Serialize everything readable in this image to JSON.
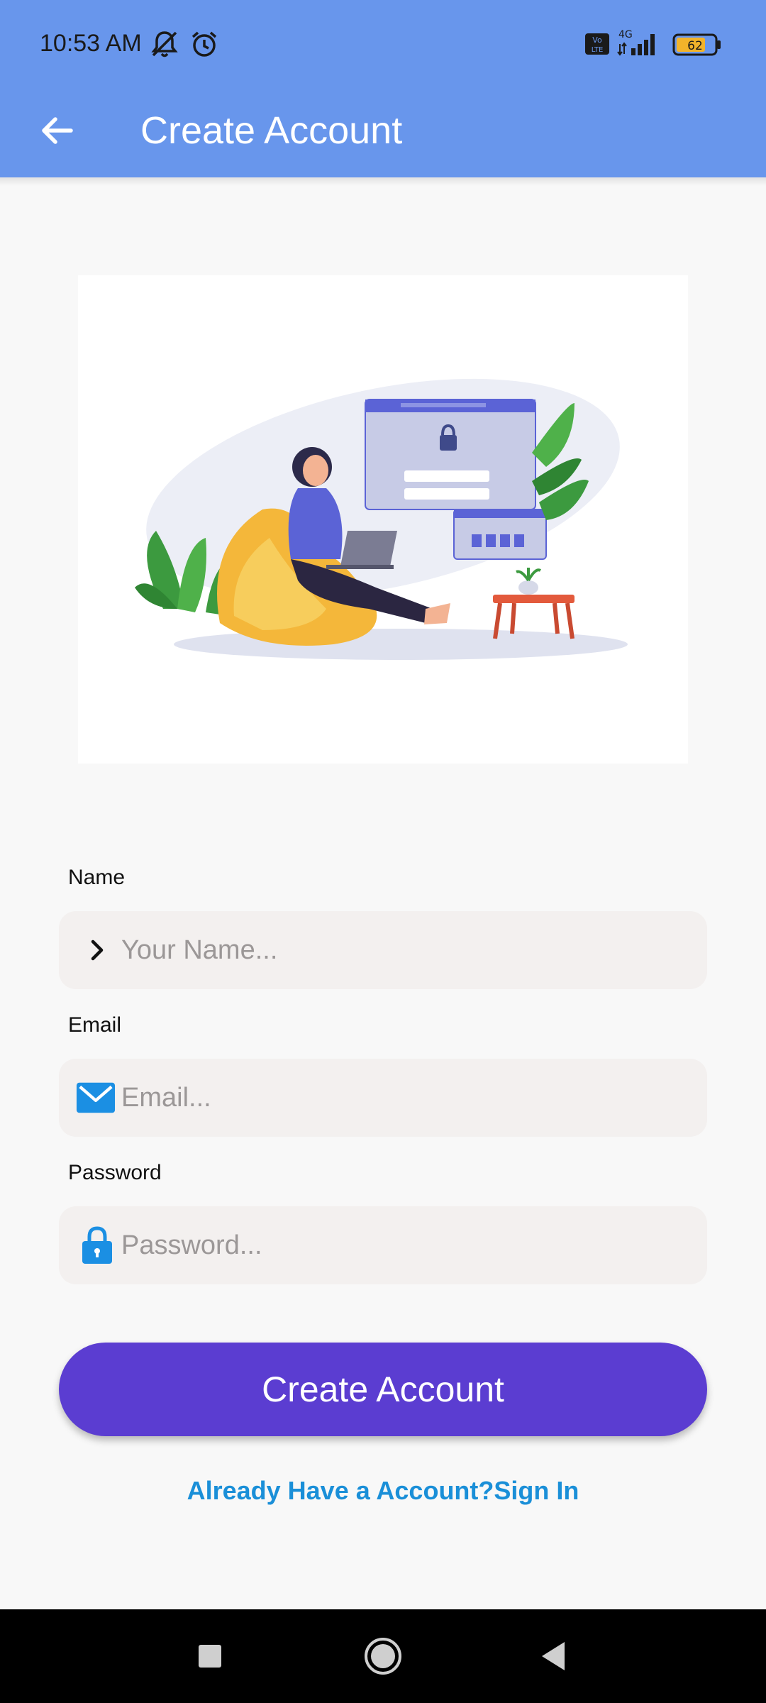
{
  "status_bar": {
    "time": "10:53 AM",
    "network": "4G",
    "volte": "Vo LTE",
    "battery": "62",
    "icons": [
      "mute-notifications-icon",
      "alarm-icon",
      "volte-icon",
      "signal-icon",
      "battery-icon"
    ]
  },
  "app_bar": {
    "title": "Create Account",
    "back_icon": "arrow-back-icon",
    "color": "#6896ec"
  },
  "illustration": {
    "subject": "woman-with-laptop-login-illustration"
  },
  "form": {
    "name": {
      "label": "Name",
      "placeholder": "Your Name...",
      "icon": "chevron-right-icon"
    },
    "email": {
      "label": "Email",
      "placeholder": "Email...",
      "icon": "mail-icon"
    },
    "password": {
      "label": "Password",
      "placeholder": "Password...",
      "icon": "lock-icon"
    }
  },
  "actions": {
    "create_button": "Create Account",
    "create_button_color": "#5b3dd1",
    "signin_link": "Already Have a Account?Sign In",
    "signin_color": "#1a8fd8"
  },
  "nav_bar": {
    "icons": [
      "recents-square-icon",
      "home-circle-icon",
      "back-triangle-icon"
    ]
  }
}
